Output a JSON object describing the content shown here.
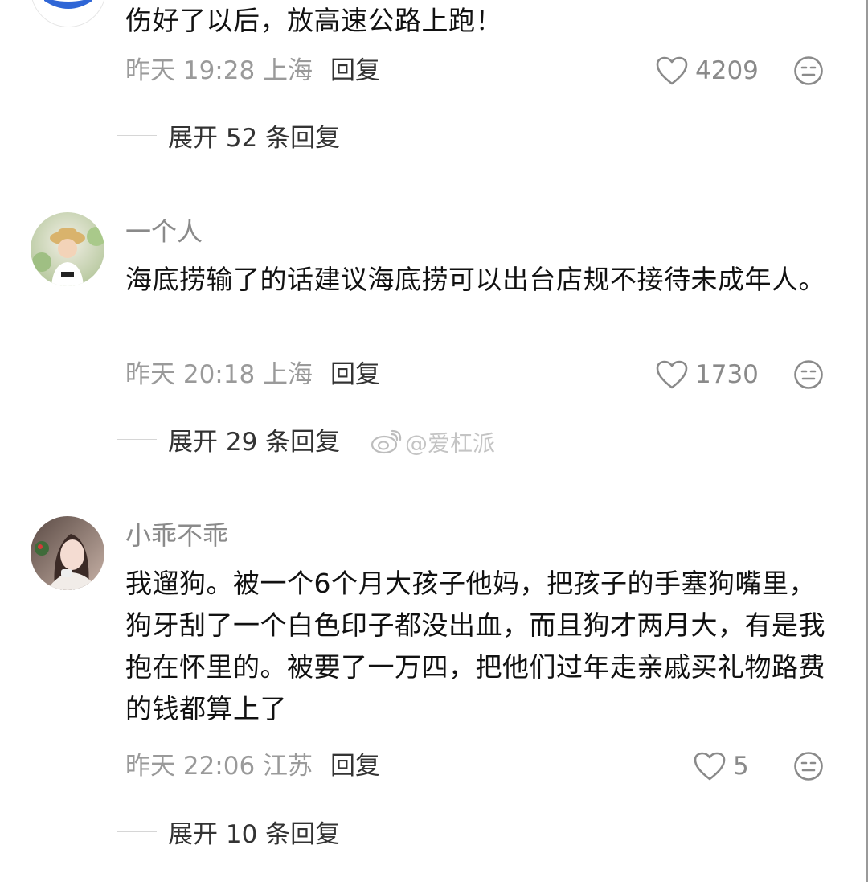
{
  "comments": [
    {
      "username": "",
      "text": "伤好了以后，放高速公路上跑！",
      "time": "昨天 19:28 上海",
      "reply_label": "回复",
      "likes": "4209",
      "expand_label": "展开 52 条回复"
    },
    {
      "username": "一个人",
      "text": "海底捞输了的话建议海底捞可以出台店规不接待未成年人。",
      "time": "昨天 20:18 上海",
      "reply_label": "回复",
      "likes": "1730",
      "expand_label": "展开 29 条回复"
    },
    {
      "username": "小乖不乖",
      "text": "我遛狗。被一个6个月大孩子他妈，把孩子的手塞狗嘴里，狗牙刮了一个白色印子都没出血，而且狗才两月大，有是我抱在怀里的。被要了一万四，把他们过年走亲戚买礼物路费的钱都算上了",
      "time": "昨天 22:06 江苏",
      "reply_label": "回复",
      "likes": "5",
      "expand_label": "展开 10 条回复"
    }
  ],
  "watermark": "@爱杠派",
  "icons": {
    "like": "heart-outline-icon",
    "more": "neutral-face-icon",
    "watermark": "weibo-logo-icon"
  },
  "colors": {
    "meta_gray": "#9a9a9a",
    "text": "#111111",
    "reply": "#333333"
  }
}
